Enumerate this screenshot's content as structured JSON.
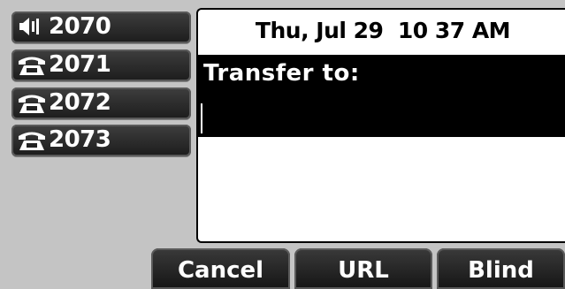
{
  "line_keys": [
    {
      "icon": "speaker-icon",
      "label": "2070"
    },
    {
      "icon": "phone-handset-icon",
      "label": "2071"
    },
    {
      "icon": "phone-handset-icon",
      "label": "2072"
    },
    {
      "icon": "phone-handset-icon",
      "label": "2073"
    }
  ],
  "status": {
    "datetime": "Thu, Jul 29  10 37 AM"
  },
  "transfer": {
    "label": "Transfer to:",
    "value": ""
  },
  "softkeys": [
    {
      "label": "Cancel"
    },
    {
      "label": "URL"
    },
    {
      "label": "Blind"
    }
  ]
}
